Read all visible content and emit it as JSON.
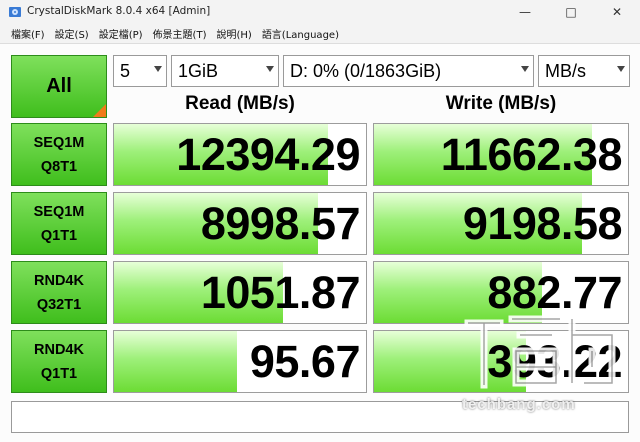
{
  "window": {
    "title": "CrystalDiskMark 8.0.4 x64 [Admin]"
  },
  "menu": [
    "檔案(F)",
    "設定(S)",
    "設定檔(P)",
    "佈景主題(T)",
    "說明(H)",
    "語言(Language)"
  ],
  "controls": {
    "all_label": "All",
    "count": "5",
    "size": "1GiB",
    "drive": "D: 0% (0/1863GiB)",
    "unit": "MB/s"
  },
  "headers": {
    "read": "Read (MB/s)",
    "write": "Write (MB/s)"
  },
  "tests": [
    {
      "line1": "SEQ1M",
      "line2": "Q8T1",
      "read": "12394.29",
      "write": "11662.38",
      "read_fill": 0.85,
      "write_fill": 0.86
    },
    {
      "line1": "SEQ1M",
      "line2": "Q1T1",
      "read": "8998.57",
      "write": "9198.58",
      "read_fill": 0.81,
      "write_fill": 0.82
    },
    {
      "line1": "RND4K",
      "line2": "Q32T1",
      "read": "1051.87",
      "write": "882.77",
      "read_fill": 0.67,
      "write_fill": 0.66
    },
    {
      "line1": "RND4K",
      "line2": "Q1T1",
      "read": "95.67",
      "write": "393.22",
      "read_fill": 0.49,
      "write_fill": 0.6
    }
  ],
  "watermark": {
    "text": "techbang.com"
  },
  "colors": {
    "accent_green": "#3fbe1c",
    "corner_orange": "#f07a1a"
  }
}
